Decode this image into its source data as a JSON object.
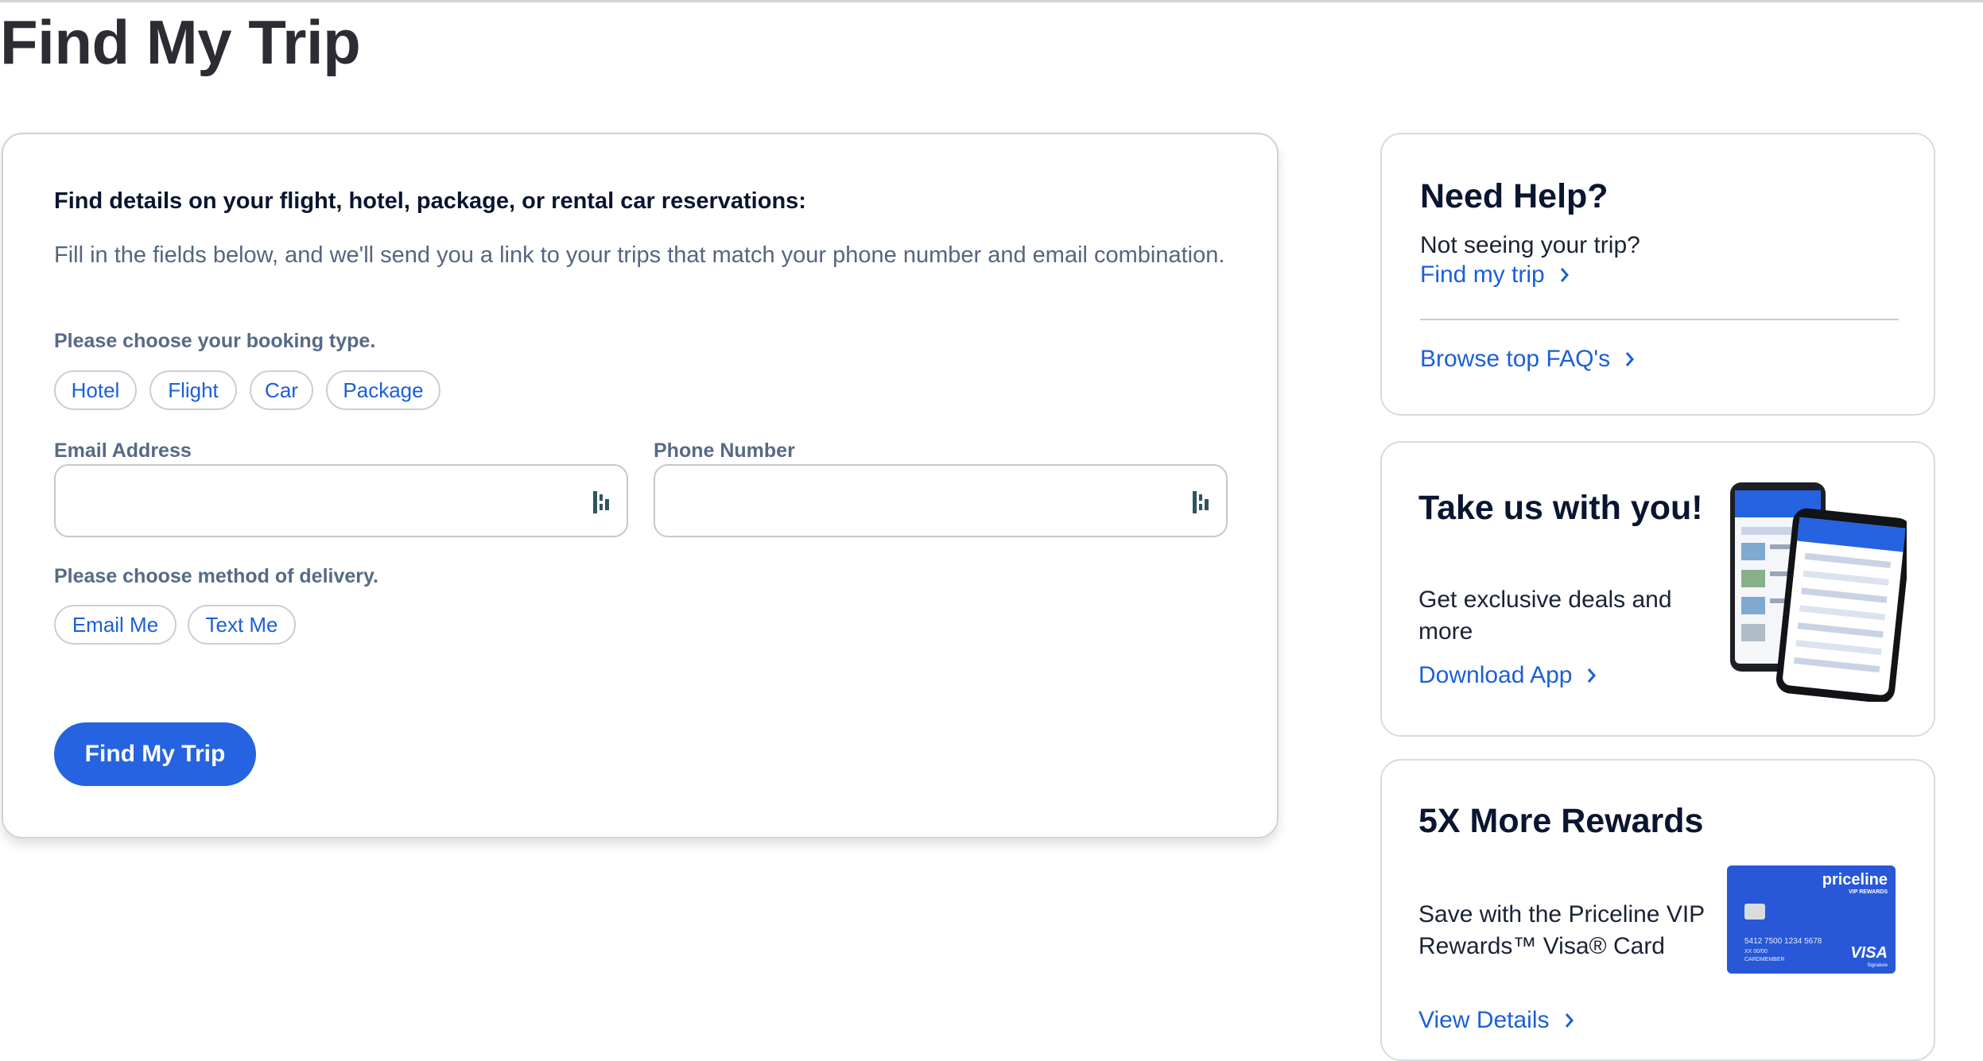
{
  "page": {
    "title": "Find My Trip"
  },
  "form": {
    "heading": "Find details on your flight, hotel, package, or rental car reservations:",
    "description": "Fill in the fields below, and we'll send you a link to your trips that match your phone number and email combination.",
    "booking_type_label": "Please choose your booking type.",
    "booking_types": [
      "Hotel",
      "Flight",
      "Car",
      "Package"
    ],
    "email_label": "Email Address",
    "email_value": "",
    "phone_label": "Phone Number",
    "phone_value": "",
    "delivery_label": "Please choose method of delivery.",
    "delivery_methods": [
      "Email Me",
      "Text Me"
    ],
    "submit_label": "Find My Trip"
  },
  "help_card": {
    "title": "Need Help?",
    "text": "Not seeing your trip?",
    "link1": "Find my trip",
    "link2": "Browse top FAQ's"
  },
  "app_card": {
    "title": "Take us with you!",
    "text": "Get exclusive deals and more",
    "link": "Download App"
  },
  "rewards_card": {
    "title": "5X More Rewards",
    "text": "Save with the Priceline VIP Rewards™ Visa® Card",
    "link": "View Details",
    "card_brand": "priceline",
    "card_tier": "VIP REWARDS",
    "card_number": "5412 7500 1234 5678",
    "card_exp": "XX 00/00",
    "card_holder": "CARDMEMBER",
    "card_network": "VISA",
    "card_network_sub": "Signature"
  },
  "colors": {
    "accent": "#2563e0",
    "link": "#1b5fd8",
    "heading": "#0a1530",
    "muted": "#566a86"
  }
}
